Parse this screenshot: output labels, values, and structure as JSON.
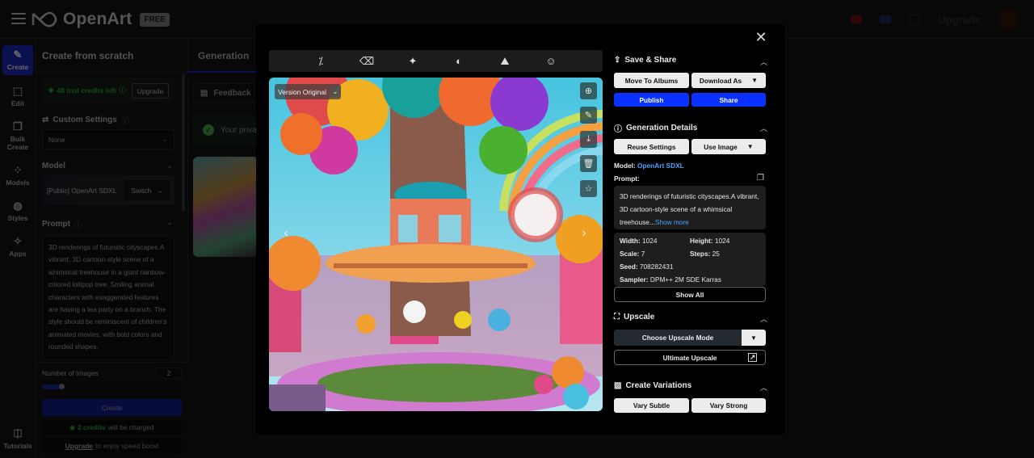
{
  "topbar": {
    "logo_text": "OpenArt",
    "plan_badge": "FREE",
    "upgrade_link": "Upgrade",
    "icons": [
      "menu-icon",
      "youtube-icon",
      "discord-icon",
      "help-icon",
      "avatar"
    ]
  },
  "leftnav": {
    "items": [
      {
        "label": "Create",
        "icon": "create-icon",
        "active": true
      },
      {
        "label": "Edit",
        "icon": "edit-icon"
      },
      {
        "label": "Bulk Create",
        "icon": "bulk-create-icon"
      },
      {
        "label": "Models",
        "icon": "models-icon"
      },
      {
        "label": "Styles",
        "icon": "styles-icon"
      },
      {
        "label": "Apps",
        "icon": "apps-icon"
      }
    ],
    "tutorials": "Tutorials"
  },
  "panel": {
    "title": "Create from scratch",
    "credits_text": "48 trial credits left",
    "upgrade_button": "Upgrade",
    "custom_settings_label": "Custom Settings",
    "custom_settings_value": "None",
    "model_label": "Model",
    "model_name": "[Public] OpenArt SDXL",
    "switch_button": "Switch",
    "prompt_label": "Prompt",
    "prompt_text": "3D renderings of futuristic cityscapes.A vibrant, 3D cartoon-style scene of a whimsical treehouse in a giant rainbow-colored lollipop tree. Smiling animal characters with exaggerated features are having a tea party on a branch. The style should be reminiscent of children's animated movies, with bold colors and rounded shapes.",
    "num_images_label": "Number of Images",
    "num_images_value": "2",
    "num_images_slider_fraction": 0.14,
    "create_button": "Create",
    "charge_credits": "2 credits",
    "charge_suffix": "will be charged",
    "speed_link": "Upgrade",
    "speed_suffix": "to enjoy speed boost"
  },
  "generation": {
    "tab_label": "Generation",
    "feedback_button": "Feedback",
    "privacy_text": "Your priva"
  },
  "modal": {
    "close_icon": "close-icon",
    "toolbar_icons": [
      "magic-wand-icon",
      "eraser-icon",
      "sparkle-expand-icon",
      "palette-icon",
      "image-edit-icon",
      "face-icon"
    ],
    "version_label": "Version Original",
    "image_side_tools": [
      "zoom-in-icon",
      "pencil-icon",
      "download-icon",
      "trash-icon",
      "star-icon"
    ],
    "save_share": {
      "title": "Save & Share",
      "move_to_albums": "Move To Albums",
      "download_as": "Download As",
      "publish": "Publish",
      "share": "Share"
    },
    "generation_details": {
      "title": "Generation Details",
      "reuse_settings": "Reuse Settings",
      "use_image": "Use Image",
      "model_label": "Model:",
      "model_value": "OpenArt SDXL",
      "prompt_label": "Prompt:",
      "prompt_preview": "3D renderings of futuristic cityscapes.A vibrant, 3D cartoon-style scene of a whimsical treehouse...",
      "show_more": "Show more",
      "width_label": "Width:",
      "width_value": "1024",
      "height_label": "Height:",
      "height_value": "1024",
      "scale_label": "Scale:",
      "scale_value": "7",
      "steps_label": "Steps:",
      "steps_value": "25",
      "seed_label": "Seed:",
      "seed_value": "708282431",
      "sampler_label": "Sampler:",
      "sampler_value": "DPM++ 2M SDE Karras",
      "show_all": "Show All"
    },
    "upscale": {
      "title": "Upscale",
      "choose_mode": "Choose Upscale Mode",
      "ultimate": "Ultimate Upscale"
    },
    "variations": {
      "title": "Create Variations",
      "vary_subtle": "Vary Subtle",
      "vary_strong": "Vary Strong"
    }
  },
  "colors": {
    "accent_blue": "#0a31ff",
    "nav_active": "#1a28c8",
    "credits_green": "#2fb34a",
    "link_blue": "#4aa3ff"
  }
}
